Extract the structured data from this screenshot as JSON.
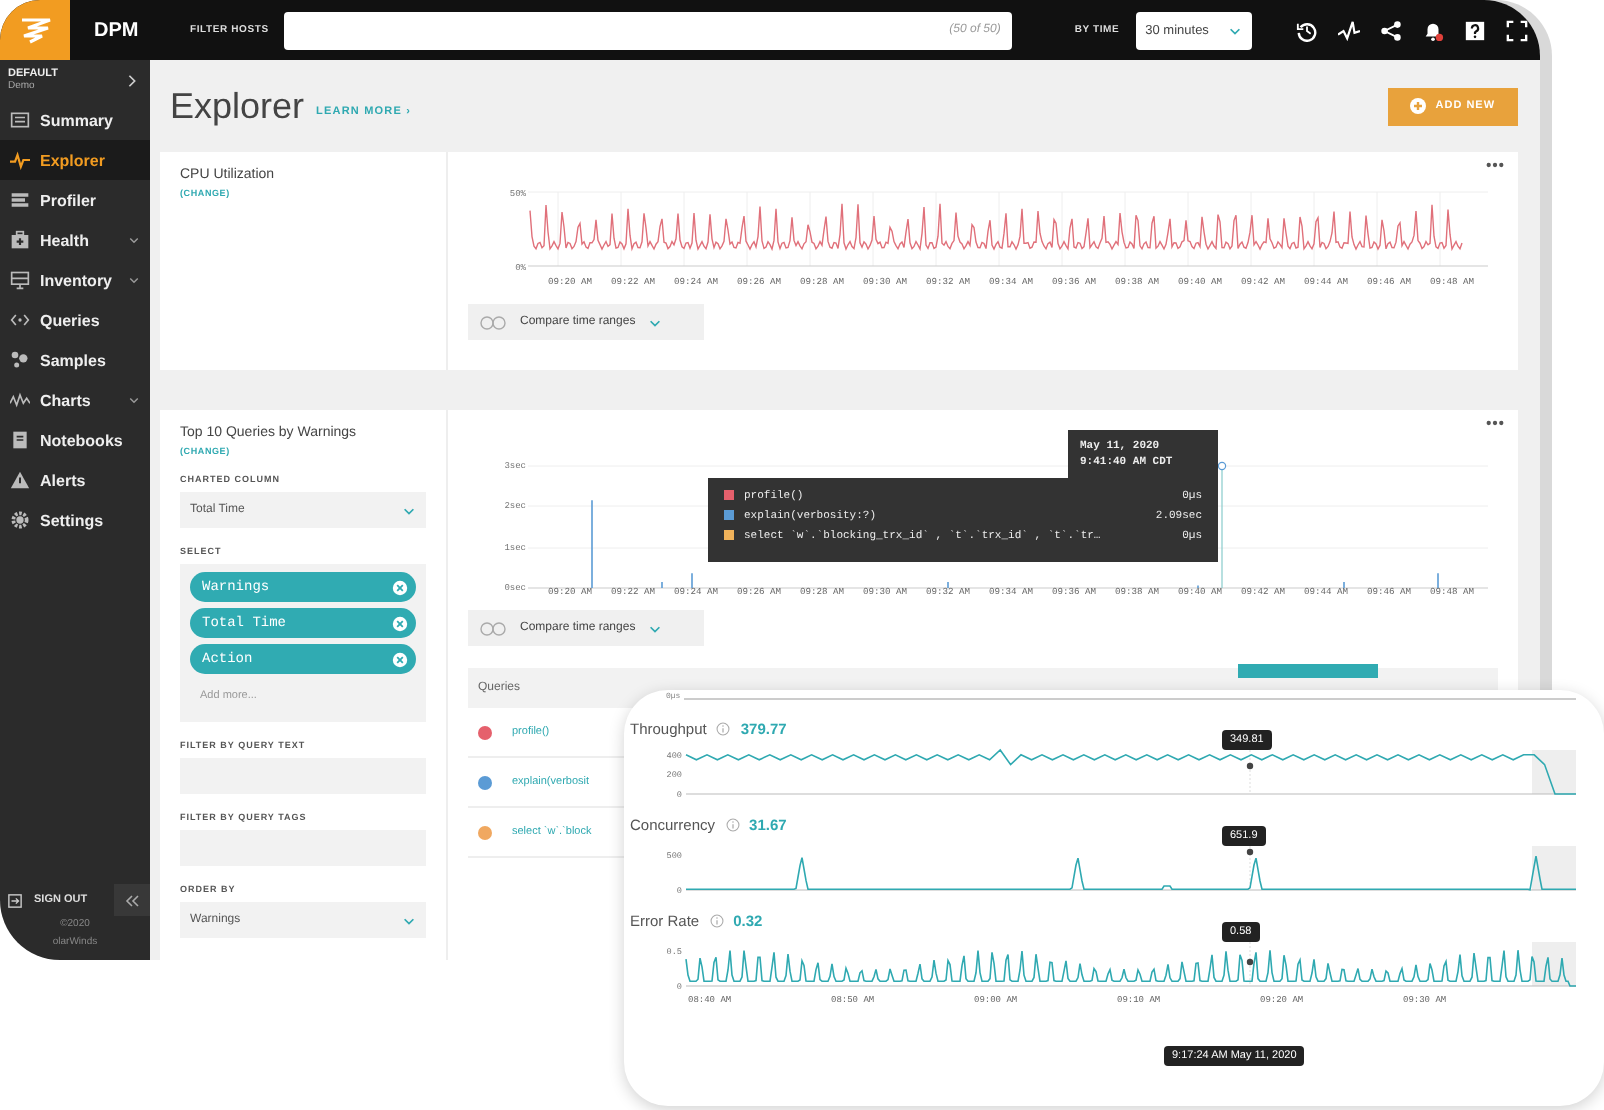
{
  "topbar": {
    "logo_text": "DPM",
    "filter_label": "FILTER HOSTS",
    "filter_count": "(50 of 50)",
    "time_label": "BY TIME",
    "time_value": "30 minutes",
    "notification": true
  },
  "sidebar": {
    "context_title": "DEFAULT",
    "context_sub": "Demo",
    "items": [
      {
        "label": "Summary",
        "selected": false,
        "expandable": false
      },
      {
        "label": "Explorer",
        "selected": true,
        "expandable": false
      },
      {
        "label": "Profiler",
        "selected": false,
        "expandable": false
      },
      {
        "label": "Health",
        "selected": false,
        "expandable": true
      },
      {
        "label": "Inventory",
        "selected": false,
        "expandable": true
      },
      {
        "label": "Queries",
        "selected": false,
        "expandable": false
      },
      {
        "label": "Samples",
        "selected": false,
        "expandable": false
      },
      {
        "label": "Charts",
        "selected": false,
        "expandable": true
      },
      {
        "label": "Notebooks",
        "selected": false,
        "expandable": false
      },
      {
        "label": "Alerts",
        "selected": false,
        "expandable": false
      },
      {
        "label": "Settings",
        "selected": false,
        "expandable": false
      }
    ],
    "sign_out": "SIGN OUT",
    "copyright": "©2020",
    "company": "olarWinds"
  },
  "page": {
    "title": "Explorer",
    "learn_more": "LEARN MORE ›",
    "add_button": "ADD NEW"
  },
  "cpu_card": {
    "title": "CPU Utilization",
    "change": "(CHANGE)",
    "y_ticks": [
      "50%",
      "0%"
    ],
    "x_ticks": [
      "09:20 AM",
      "09:22 AM",
      "09:24 AM",
      "09:26 AM",
      "09:28 AM",
      "09:30 AM",
      "09:32 AM",
      "09:34 AM",
      "09:36 AM",
      "09:38 AM",
      "09:40 AM",
      "09:42 AM",
      "09:44 AM",
      "09:46 AM",
      "09:48 AM"
    ],
    "compare": "Compare time ranges"
  },
  "queries_card": {
    "title": "Top 10 Queries by Warnings",
    "change": "(CHANGE)",
    "charted_label": "CHARTED COLUMN",
    "charted_value": "Total Time",
    "select_label": "SELECT",
    "chips": [
      "Warnings",
      "Total Time",
      "Action"
    ],
    "add_more": "Add more...",
    "text_filter_label": "FILTER BY QUERY TEXT",
    "tags_filter_label": "FILTER BY QUERY TAGS",
    "order_label": "ORDER BY",
    "order_value": "Warnings",
    "y_ticks": [
      "3sec",
      "2sec",
      "1sec",
      "0sec"
    ],
    "x_ticks": [
      "09:20 AM",
      "09:22 AM",
      "09:24 AM",
      "09:26 AM",
      "09:28 AM",
      "09:30 AM",
      "09:32 AM",
      "09:34 AM",
      "09:36 AM",
      "09:38 AM",
      "09:40 AM",
      "09:42 AM",
      "09:44 AM",
      "09:46 AM",
      "09:48 AM"
    ],
    "tooltip": {
      "date": "May 11, 2020",
      "time": "9:41:40 AM CDT",
      "rows": [
        {
          "label": "profile()",
          "value": "0µs",
          "color": "#e5606c"
        },
        {
          "label": "explain(verbosity:?)",
          "value": "2.09sec",
          "color": "#5b9bd5"
        },
        {
          "label": "select `w`.`blocking_trx_id` , `t`.`trx_id` , `t`.`tr…",
          "value": "0µs",
          "color": "#f0b25a"
        }
      ]
    },
    "compare": "Compare time ranges",
    "table_header": "Queries",
    "rows": [
      {
        "label": "profile()",
        "color": "#e5606c"
      },
      {
        "label": "explain(verbosit",
        "color": "#5b9bd5"
      },
      {
        "label": "select `w`.`block",
        "color": "#f0a860"
      }
    ]
  },
  "overlay": {
    "top_tick": "0µs",
    "metrics": [
      {
        "title": "Throughput",
        "value": "379.77",
        "marker": "349.81",
        "chart_data": {
          "type": "line",
          "ylim": [
            0,
            450
          ],
          "yticks": [
            0,
            200,
            400
          ],
          "series": [
            {
              "color": "#2fa9b1",
              "values": [
                400,
                350,
                400,
                350,
                400,
                350,
                400,
                350,
                400,
                350,
                400,
                350,
                400,
                350,
                400,
                350,
                400,
                350,
                400,
                350,
                400,
                350,
                400,
                350,
                400,
                350,
                400,
                350,
                400,
                350,
                450,
                300,
                400,
                350,
                400,
                350,
                400,
                350,
                400,
                350,
                400,
                350,
                400,
                350,
                400,
                350,
                400,
                350,
                400,
                350,
                400,
                350,
                400,
                350,
                400,
                350,
                400,
                350,
                400,
                350,
                400,
                350,
                400,
                350,
                400,
                350,
                400,
                350,
                400,
                350,
                400,
                350,
                400,
                350,
                400,
                350,
                400,
                350,
                400,
                350,
                400,
                400,
                300,
                0,
                0,
                0
              ]
            }
          ]
        }
      },
      {
        "title": "Concurrency",
        "value": "31.67",
        "marker": "651.9",
        "kind": "spikes",
        "y_ticks": [
          "500",
          "0"
        ]
      },
      {
        "title": "Error Rate",
        "value": "0.32",
        "marker": "0.58",
        "kind": "waves",
        "y_ticks": [
          "0.5",
          "0"
        ]
      }
    ],
    "x_ticks": [
      "08:40 AM",
      "08:50 AM",
      "09:00 AM",
      "09:10 AM",
      "09:20 AM",
      "09:30 AM"
    ],
    "time_tooltip": "9:17:24 AM May 11, 2020"
  }
}
